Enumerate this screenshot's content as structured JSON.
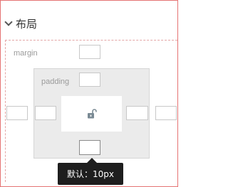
{
  "section": {
    "title": "布局",
    "toggle_icon": "chevron-down-icon"
  },
  "margin": {
    "label": "margin",
    "top": "",
    "left": "",
    "right": ""
  },
  "padding": {
    "label": "padding",
    "top": "",
    "left": "",
    "right": "",
    "bottom": ""
  },
  "content": {
    "icon": "unlock-icon"
  },
  "tooltip": {
    "text": "默认：10px"
  },
  "colors": {
    "frame_border": "#e57373",
    "margin_dashed": "#e3a5a5",
    "padding_bg": "#ebebeb",
    "tooltip_bg": "#1e1e1e",
    "lock_icon": "#7a8a94"
  }
}
